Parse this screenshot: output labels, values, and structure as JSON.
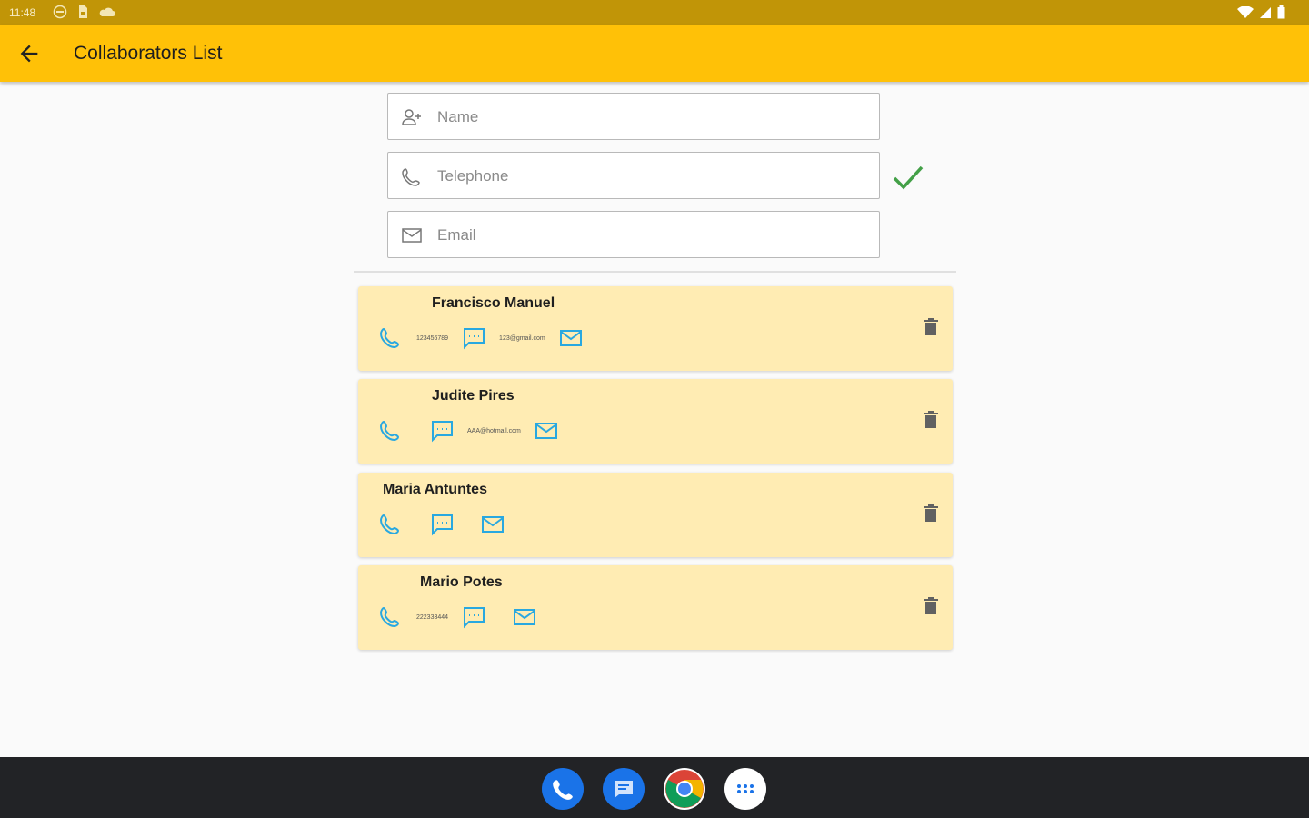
{
  "status": {
    "time": "11:48"
  },
  "appbar": {
    "title": "Collaborators List"
  },
  "form": {
    "name_placeholder": "Name",
    "telephone_placeholder": "Telephone",
    "email_placeholder": "Email"
  },
  "collaborators": [
    {
      "name": "Francisco Manuel",
      "phone": "123456789",
      "email": "123@gmail.com"
    },
    {
      "name": "Judite Pires",
      "phone": "",
      "email": "AAA@hotmail.com"
    },
    {
      "name": "Maria Antuntes",
      "phone": "",
      "email": ""
    },
    {
      "name": "Mario Potes",
      "phone": "222333444",
      "email": ""
    }
  ],
  "dock": [
    "phone-app",
    "messages-app",
    "chrome-app",
    "apps-launcher"
  ],
  "colors": {
    "primary": "#ffc107",
    "statusbar": "#c19507",
    "card": "#ffecb3",
    "accent_icon": "#29a8e0",
    "check": "#43a047"
  }
}
